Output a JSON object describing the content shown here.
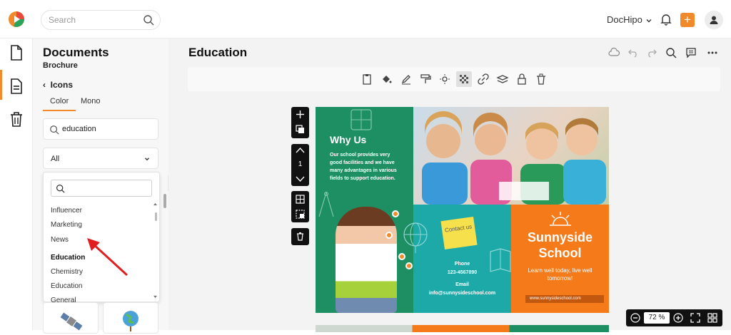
{
  "topbar": {
    "search_placeholder": "Search",
    "account_label": "DocHipo",
    "accent_color": "#f08a2a"
  },
  "panel": {
    "title": "Documents",
    "subtitle": "Brochure",
    "back_label": "Icons",
    "tabs": [
      {
        "label": "Color",
        "active": true
      },
      {
        "label": "Mono",
        "active": false
      }
    ],
    "search_value": "education",
    "category_select": "All",
    "dropdown": {
      "search_value": "",
      "items": [
        {
          "label": "Influencer",
          "type": "item"
        },
        {
          "label": "Marketing",
          "type": "item"
        },
        {
          "label": "News",
          "type": "item"
        },
        {
          "label": "Education",
          "type": "heading"
        },
        {
          "label": "Chemistry",
          "type": "item"
        },
        {
          "label": "Education",
          "type": "item"
        },
        {
          "label": "General",
          "type": "item"
        }
      ]
    }
  },
  "main": {
    "doc_title": "Education",
    "page_number": "1",
    "zoom": "72",
    "zoom_unit": "%"
  },
  "brochure": {
    "why_title": "Why Us",
    "why_body": "Our school provides very good facilities and we have many advantages in various fields to support education.",
    "sticky_note": "Contact us",
    "phone_label": "Phone",
    "phone_value": "123-4567890",
    "email_label": "Email",
    "email_value": "info@sunnysideschool.com",
    "school_title_1": "Sunnyside",
    "school_title_2": "School",
    "tagline": "Learn well today, live well tomorrow!",
    "url": "www.sunnysideschool.com"
  }
}
